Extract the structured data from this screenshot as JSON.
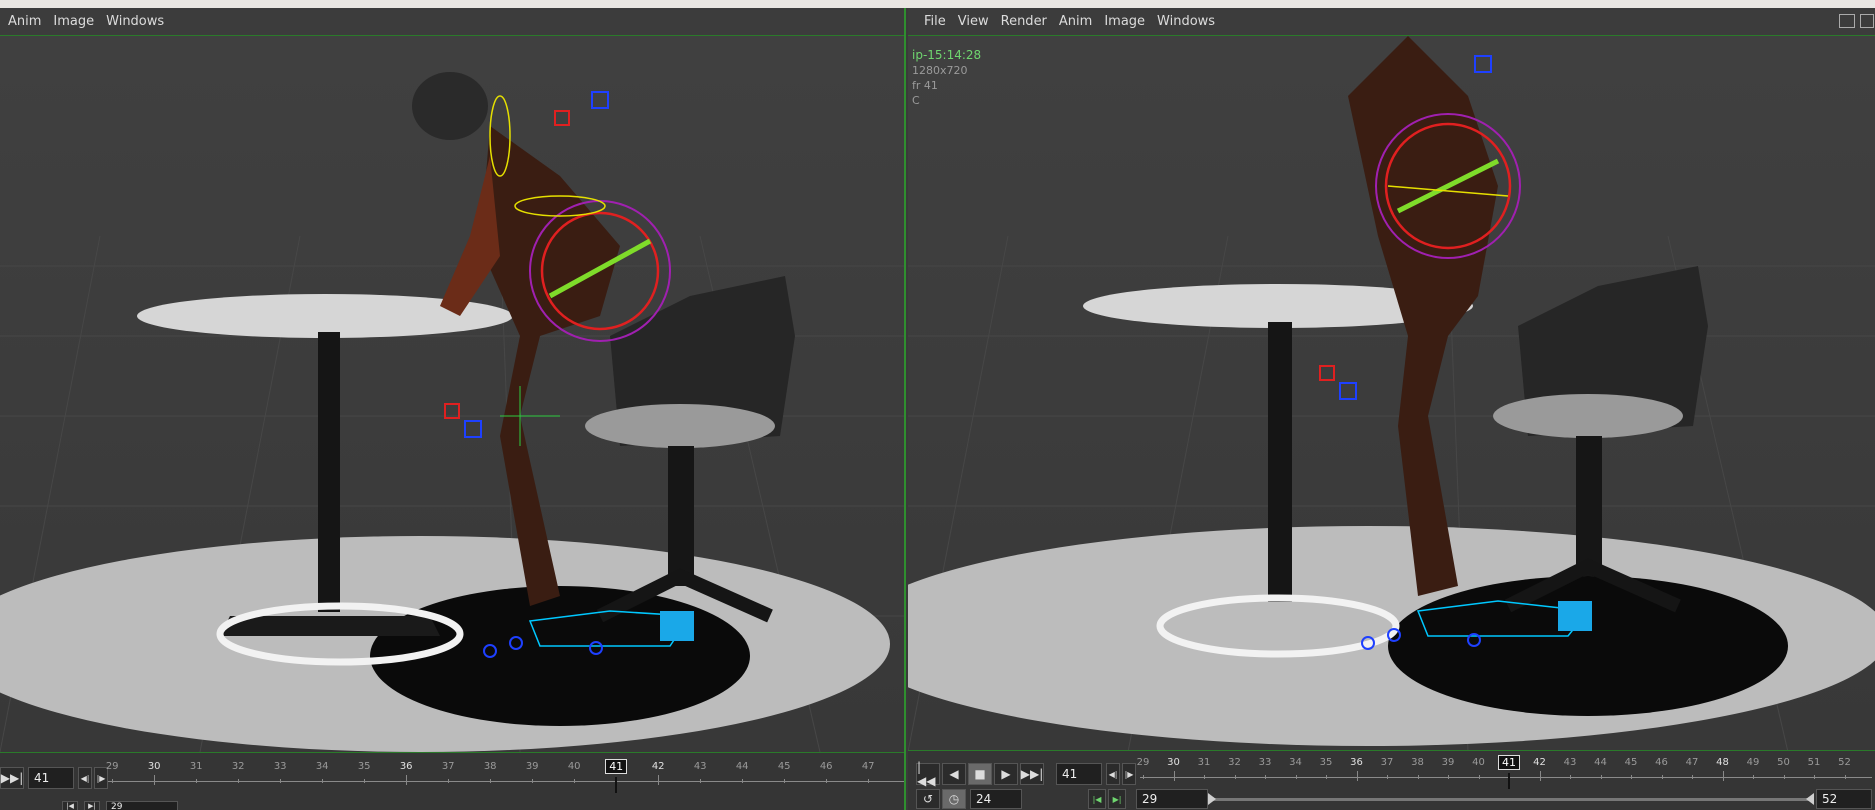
{
  "left_pane": {
    "menu": [
      "Anim",
      "Image",
      "Windows"
    ],
    "frame": "41",
    "range_start": "29",
    "ticks": [
      "29",
      "30",
      "31",
      "32",
      "33",
      "34",
      "35",
      "36",
      "37",
      "38",
      "39",
      "40",
      "41",
      "42",
      "43",
      "44",
      "45",
      "46",
      "47"
    ],
    "major_ticks": [
      "30",
      "36",
      "42"
    ],
    "current": "41"
  },
  "right_pane": {
    "menu": [
      "File",
      "View",
      "Render",
      "Anim",
      "Image",
      "Windows"
    ],
    "info": {
      "source": "ip-15:14:28",
      "resolution": "1280x720",
      "frame": "fr 41",
      "channel": "C"
    },
    "frame": "41",
    "fps": "24",
    "range_start": "29",
    "range_end": "52",
    "ticks": [
      "29",
      "30",
      "31",
      "32",
      "33",
      "34",
      "35",
      "36",
      "37",
      "38",
      "39",
      "40",
      "41",
      "42",
      "43",
      "44",
      "45",
      "46",
      "47",
      "48",
      "49",
      "50",
      "51",
      "52"
    ],
    "major_ticks": [
      "30",
      "36",
      "42",
      "48"
    ],
    "current": "41"
  },
  "icons": {
    "first": "skip-to-start-icon",
    "prev": "step-back-icon",
    "stop": "stop-icon",
    "play": "play-icon",
    "last": "skip-to-end-icon"
  },
  "colors": {
    "accent_green": "#2f8f2f",
    "handle_red": "#e02020",
    "handle_blue": "#1e40ff",
    "handle_cyan": "#00c8ff"
  }
}
